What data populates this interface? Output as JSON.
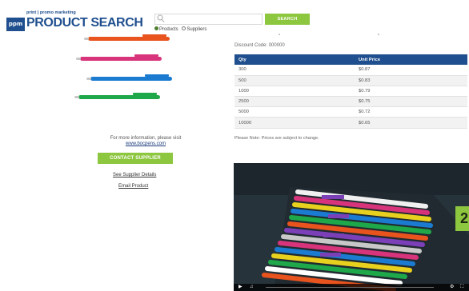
{
  "header": {
    "logo_box": "ppm",
    "tagline": "print | promo marketing",
    "title": "PRODUCT SEARCH"
  },
  "search": {
    "placeholder": "",
    "button_label": "SEARCH",
    "options": [
      "Products",
      "Suppliers"
    ],
    "selected": "Products"
  },
  "product": {
    "pen_colors": [
      "#e8531e",
      "#d8347b",
      "#1b7bd0",
      "#1fa84a"
    ],
    "info_line": "For more information, please visit",
    "info_link": "www.bocpens.com",
    "contact_label": "CONTACT SUPPLIER",
    "details_link": "See Supplier Details",
    "email_link": "Email Product"
  },
  "pricing": {
    "discount": "Discount Code: 000000",
    "headers": [
      "Qty",
      "Unit Price"
    ],
    "rows": [
      [
        "300",
        "$0.87"
      ],
      [
        "500",
        "$0.83"
      ],
      [
        "1000",
        "$0.79"
      ],
      [
        "2500",
        "$0.75"
      ],
      [
        "5000",
        "$0.72"
      ],
      [
        "10000",
        "$0.65"
      ]
    ],
    "note": "Please Note: Prices are subject to change."
  },
  "video": {
    "badge": "2"
  },
  "colors": {
    "brand_blue": "#1f4f8e",
    "accent_green": "#8dc63f"
  }
}
